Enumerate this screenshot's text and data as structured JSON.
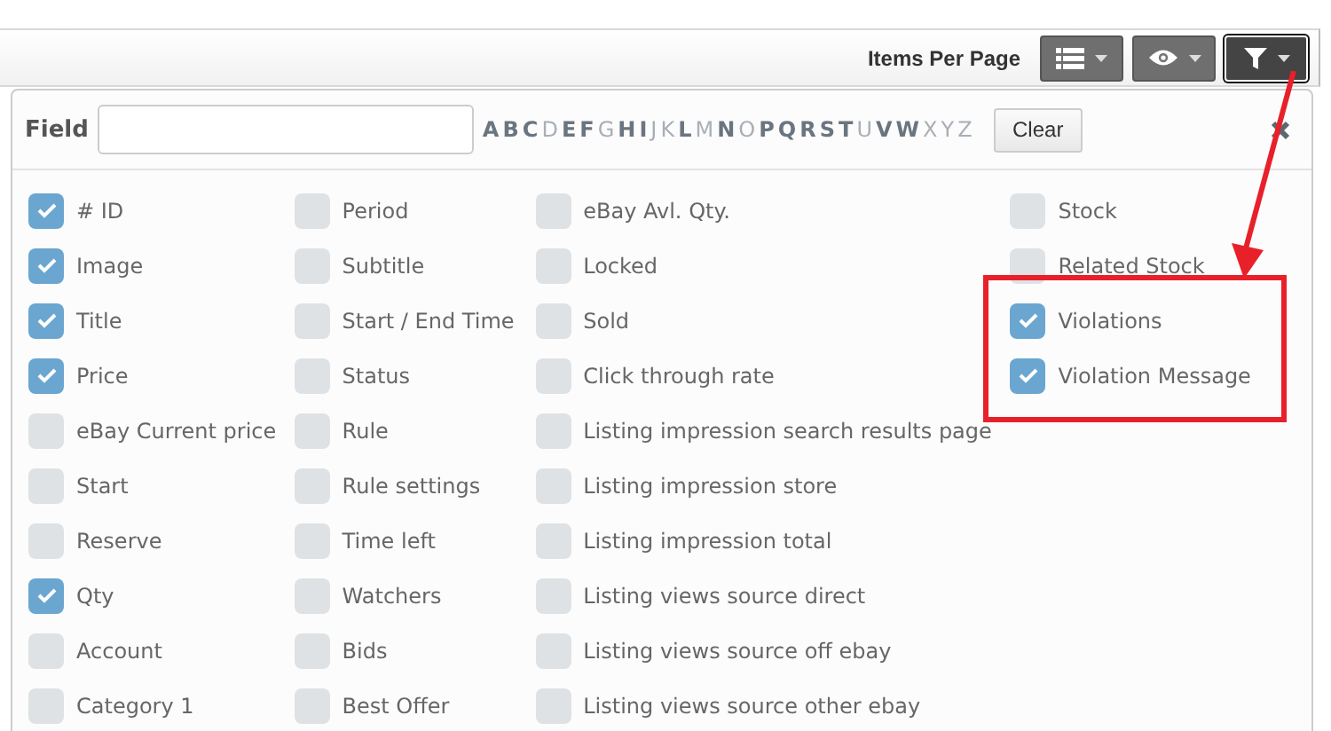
{
  "toolbar": {
    "items_per_page_label": "Items Per Page",
    "buttons": [
      {
        "kind": "list",
        "selected": false
      },
      {
        "kind": "eye",
        "selected": false
      },
      {
        "kind": "filter",
        "selected": true
      }
    ]
  },
  "field_panel": {
    "label": "Field",
    "letters": [
      {
        "letter": "A",
        "disabled": false
      },
      {
        "letter": "B",
        "disabled": false
      },
      {
        "letter": "C",
        "disabled": false
      },
      {
        "letter": "D",
        "disabled": true
      },
      {
        "letter": "E",
        "disabled": false
      },
      {
        "letter": "F",
        "disabled": false
      },
      {
        "letter": "G",
        "disabled": true
      },
      {
        "letter": "H",
        "disabled": false
      },
      {
        "letter": "I",
        "disabled": false
      },
      {
        "letter": "J",
        "disabled": true
      },
      {
        "letter": "K",
        "disabled": true
      },
      {
        "letter": "L",
        "disabled": false
      },
      {
        "letter": "M",
        "disabled": true
      },
      {
        "letter": "N",
        "disabled": false
      },
      {
        "letter": "O",
        "disabled": true
      },
      {
        "letter": "P",
        "disabled": false
      },
      {
        "letter": "Q",
        "disabled": false
      },
      {
        "letter": "R",
        "disabled": false
      },
      {
        "letter": "S",
        "disabled": false
      },
      {
        "letter": "T",
        "disabled": false
      },
      {
        "letter": "U",
        "disabled": true
      },
      {
        "letter": "V",
        "disabled": false
      },
      {
        "letter": "W",
        "disabled": false
      },
      {
        "letter": "X",
        "disabled": true
      },
      {
        "letter": "Y",
        "disabled": true
      },
      {
        "letter": "Z",
        "disabled": true
      }
    ],
    "clear_button": "Clear",
    "columns": [
      [
        {
          "label": "# ID",
          "checked": true
        },
        {
          "label": "Image",
          "checked": true
        },
        {
          "label": "Title",
          "checked": true
        },
        {
          "label": "Price",
          "checked": true
        },
        {
          "label": "eBay Current price",
          "checked": false
        },
        {
          "label": "Start",
          "checked": false
        },
        {
          "label": "Reserve",
          "checked": false
        },
        {
          "label": "Qty",
          "checked": true
        },
        {
          "label": "Account",
          "checked": false
        },
        {
          "label": "Category 1",
          "checked": false
        }
      ],
      [
        {
          "label": "Period",
          "checked": false
        },
        {
          "label": "Subtitle",
          "checked": false
        },
        {
          "label": "Start / End Time",
          "checked": false
        },
        {
          "label": "Status",
          "checked": false
        },
        {
          "label": "Rule",
          "checked": false
        },
        {
          "label": "Rule settings",
          "checked": false
        },
        {
          "label": "Time left",
          "checked": false
        },
        {
          "label": "Watchers",
          "checked": false
        },
        {
          "label": "Bids",
          "checked": false
        },
        {
          "label": "Best Offer",
          "checked": false
        }
      ],
      [
        {
          "label": "eBay Avl. Qty.",
          "checked": false
        },
        {
          "label": "Locked",
          "checked": false
        },
        {
          "label": "Sold",
          "checked": false
        },
        {
          "label": "Click through rate",
          "checked": false
        },
        {
          "label": "Listing impression search results page",
          "checked": false
        },
        {
          "label": "Listing impression store",
          "checked": false
        },
        {
          "label": "Listing impression total",
          "checked": false
        },
        {
          "label": "Listing views source direct",
          "checked": false
        },
        {
          "label": "Listing views source off ebay",
          "checked": false
        },
        {
          "label": "Listing views source other ebay",
          "checked": false
        }
      ],
      [
        {
          "label": "Stock",
          "checked": false
        },
        {
          "label": "Related Stock",
          "checked": false
        },
        {
          "label": "Violations",
          "checked": true
        },
        {
          "label": "Violation Message",
          "checked": true
        }
      ]
    ]
  }
}
